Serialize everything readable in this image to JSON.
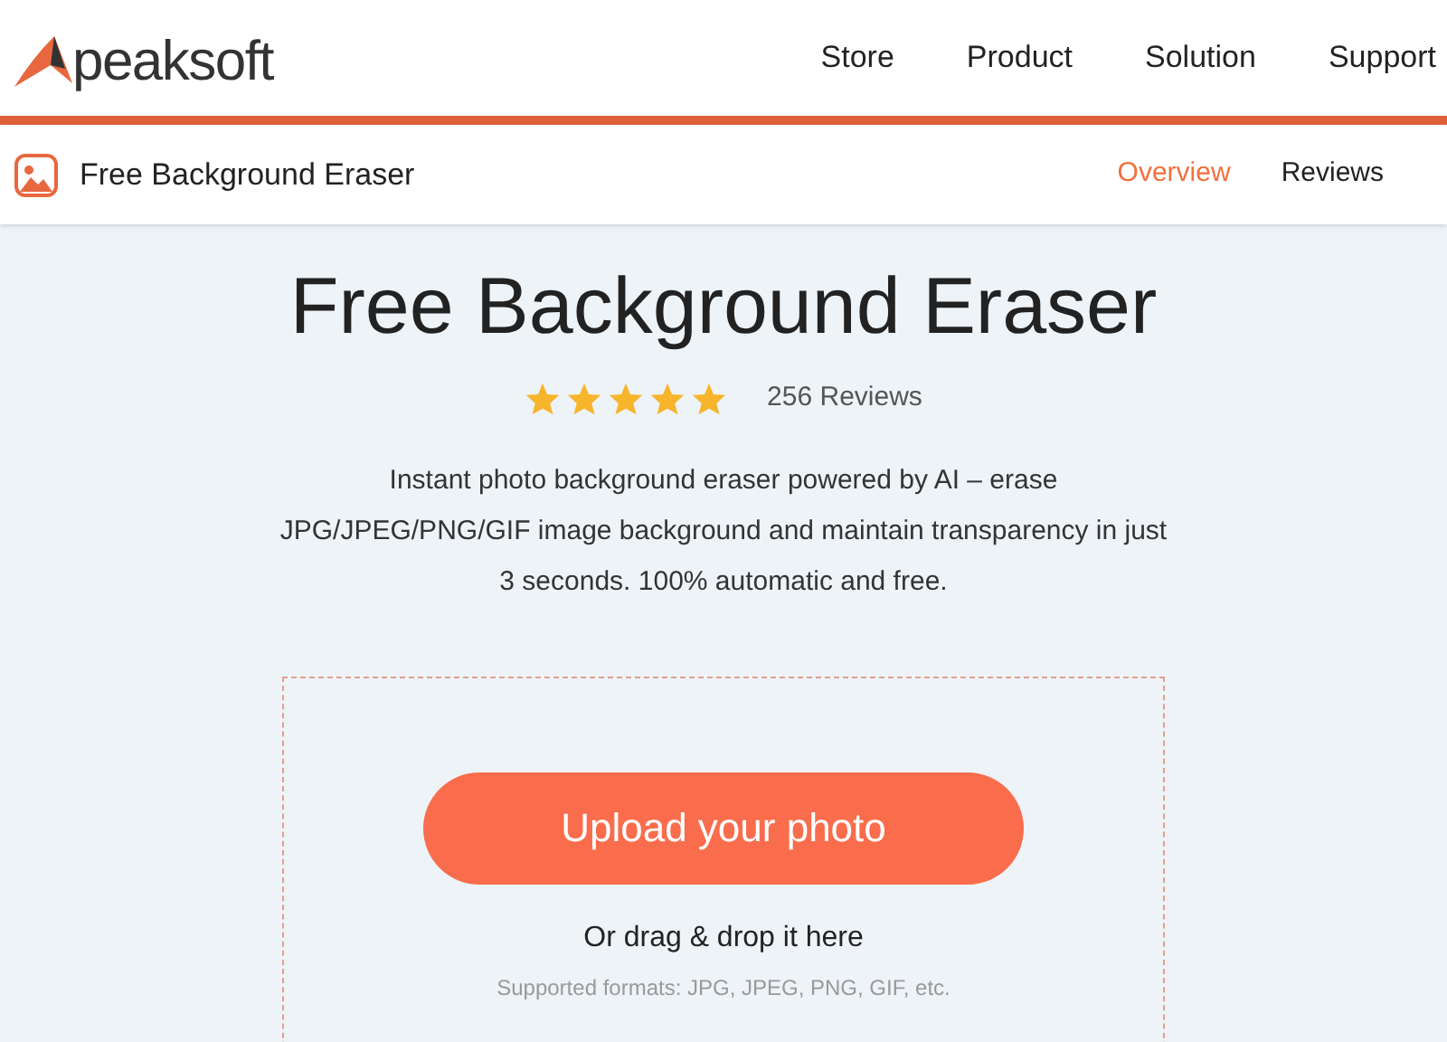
{
  "header": {
    "logo_text": "peaksoft",
    "nav": [
      {
        "label": "Store"
      },
      {
        "label": "Product"
      },
      {
        "label": "Solution"
      },
      {
        "label": "Support"
      }
    ]
  },
  "subnav": {
    "title": "Free Background Eraser",
    "tabs": [
      {
        "label": "Overview",
        "selected": true
      },
      {
        "label": "Reviews",
        "selected": false
      }
    ]
  },
  "hero": {
    "title": "Free Background Eraser",
    "stars": 5,
    "reviews": "256 Reviews",
    "description": "Instant photo background eraser powered by AI – erase JPG/JPEG/PNG/GIF image background and maintain transparency in just 3 seconds. 100% automatic and free."
  },
  "upload": {
    "button": "Upload your photo",
    "drag_text": "Or drag & drop it here",
    "formats": "Supported formats: JPG, JPEG, PNG, GIF, etc."
  }
}
